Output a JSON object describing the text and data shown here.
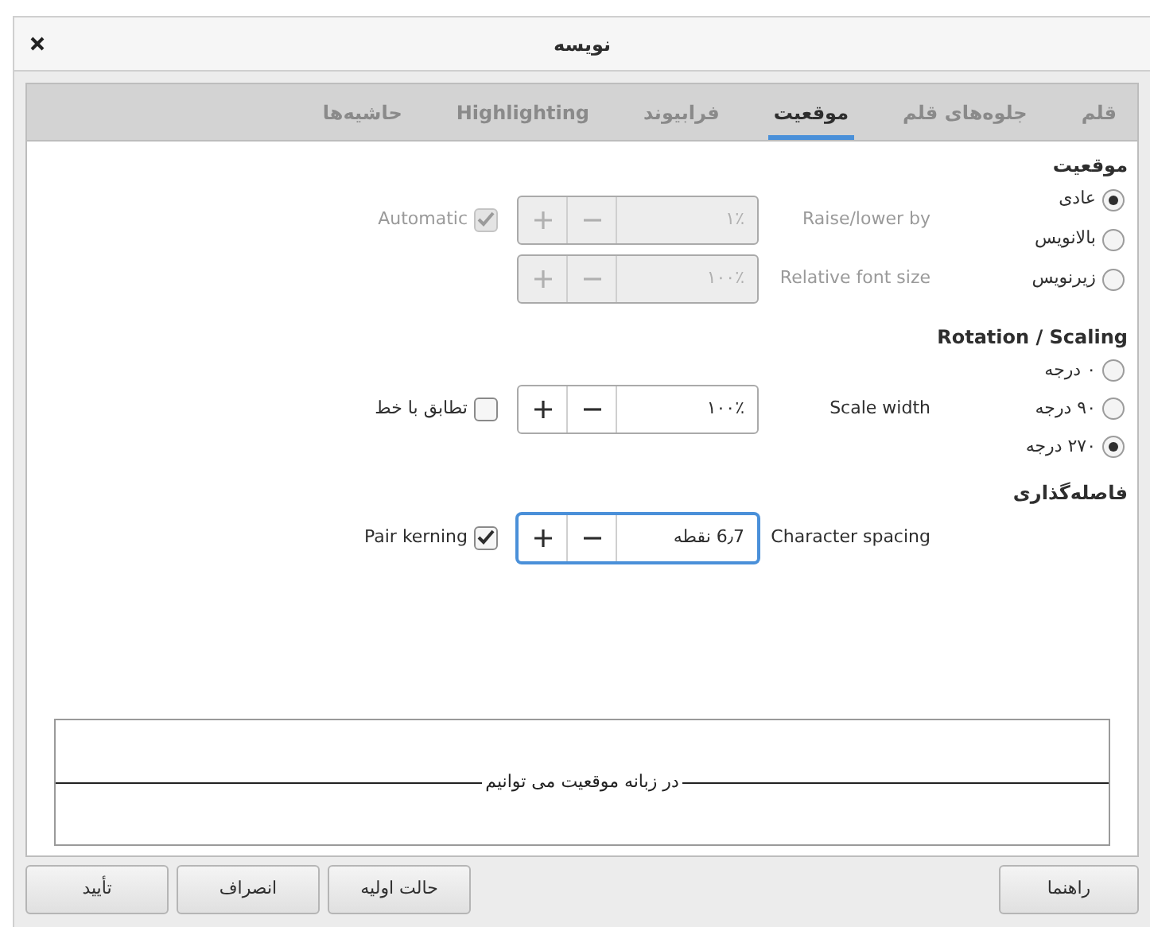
{
  "window": {
    "title": "نویسه"
  },
  "tabs": [
    {
      "label": "قلم",
      "selected": false
    },
    {
      "label": "جلوه‌های قلم",
      "selected": false
    },
    {
      "label": "موقعیت",
      "selected": true
    },
    {
      "label": "فرابیوند",
      "selected": false
    },
    {
      "label": "Highlighting",
      "selected": false
    },
    {
      "label": "حاشیه‌ها",
      "selected": false
    }
  ],
  "position": {
    "heading": "موقعیت",
    "options": [
      {
        "label": "عادی",
        "selected": true
      },
      {
        "label": "بالانویس",
        "selected": false
      },
      {
        "label": "زیرنویس",
        "selected": false
      }
    ],
    "raise_lower": {
      "label": "Raise/lower by",
      "value": "۱٪",
      "disabled": true,
      "focused": false
    },
    "relative_font_size": {
      "label": "Relative font size",
      "value": "۱۰۰٪",
      "disabled": true,
      "focused": false
    },
    "automatic": {
      "label": "Automatic",
      "checked": true,
      "disabled": true
    }
  },
  "rotation": {
    "heading": "Rotation / Scaling",
    "options": [
      {
        "label": "۰ درجه",
        "selected": false
      },
      {
        "label": "۹۰ درجه",
        "selected": false
      },
      {
        "label": "۲۷۰ درجه",
        "selected": true
      }
    ],
    "scale_width": {
      "label": "Scale width",
      "value": "۱۰۰٪",
      "disabled": false,
      "focused": false
    },
    "fit_to_line": {
      "label": "تطابق با خط",
      "checked": false,
      "disabled": false
    }
  },
  "spacing": {
    "heading": "فاصله‌گذاری",
    "character_spacing": {
      "label": "Character spacing",
      "value": "6٫7 نقطه",
      "disabled": false,
      "focused": true
    },
    "pair_kerning": {
      "label": "Pair kerning",
      "checked": true,
      "disabled": false
    }
  },
  "preview": {
    "text": "در زبانه موقعیت می توانیم"
  },
  "buttons": {
    "help": "راهنما",
    "reset": "حالت اولیه",
    "cancel": "انصراف",
    "ok": "تأیید"
  }
}
